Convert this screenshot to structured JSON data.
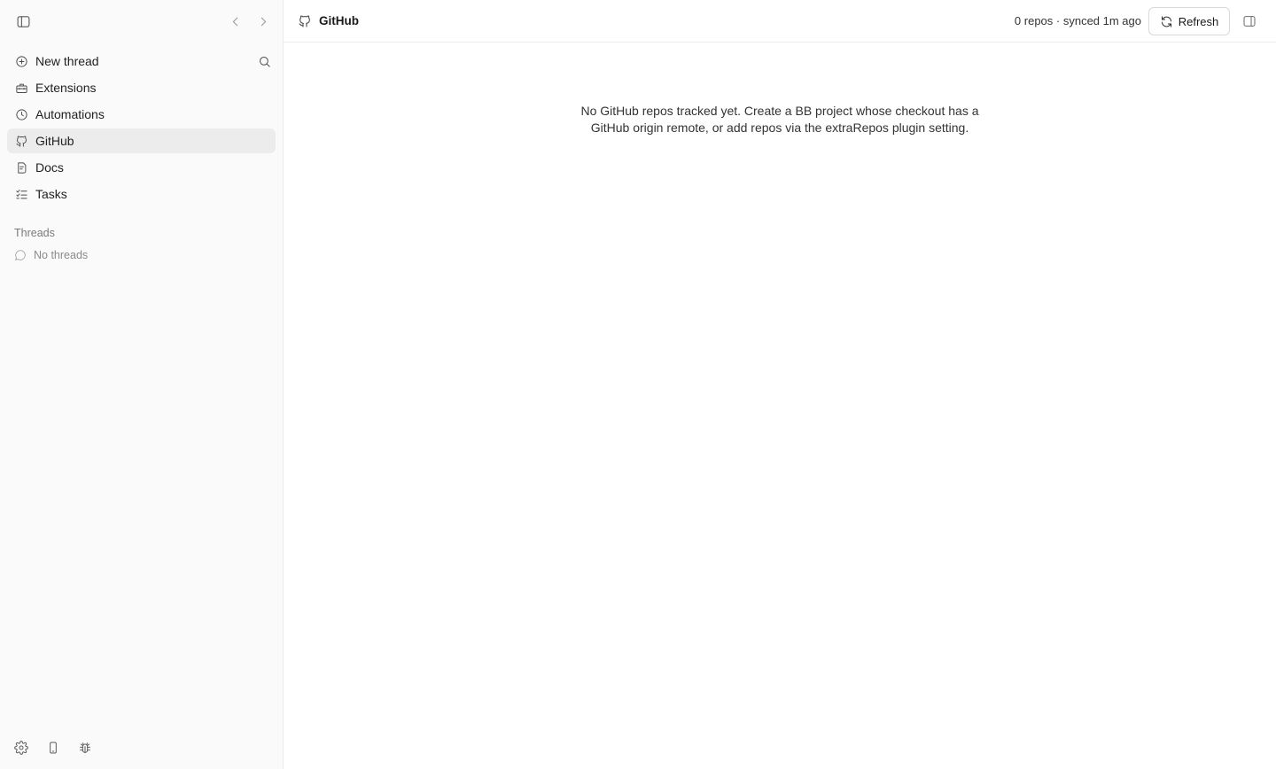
{
  "sidebar": {
    "nav": [
      {
        "label": "New thread",
        "icon": "plus-circle-icon"
      },
      {
        "label": "Extensions",
        "icon": "toolbox-icon"
      },
      {
        "label": "Automations",
        "icon": "clock-icon"
      },
      {
        "label": "GitHub",
        "icon": "github-icon",
        "active": true
      },
      {
        "label": "Docs",
        "icon": "document-icon"
      },
      {
        "label": "Tasks",
        "icon": "checklist-icon"
      }
    ],
    "threads_title": "Threads",
    "no_threads": "No threads"
  },
  "header": {
    "title": "GitHub",
    "status": "0 repos · synced 1m ago",
    "refresh_label": "Refresh"
  },
  "main": {
    "empty_line1": "No GitHub repos tracked yet. Create a BB project whose checkout has a",
    "empty_line2": "GitHub origin remote, or add repos via the extraRepos plugin setting."
  },
  "colors": {
    "sidebar_bg": "#fafafa",
    "active_item_bg": "#ececec",
    "border": "#ececec"
  }
}
